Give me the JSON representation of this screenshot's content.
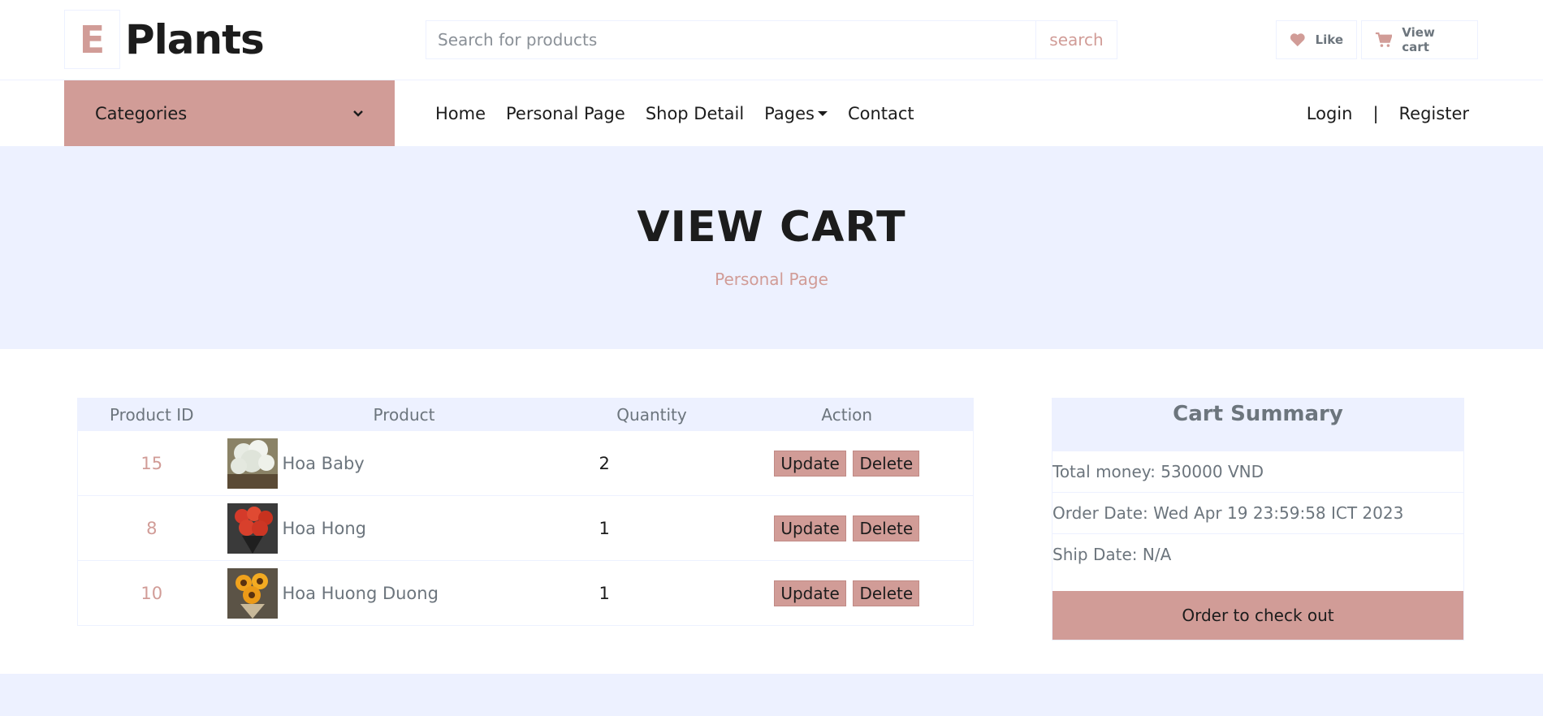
{
  "logo": {
    "letter": "E",
    "name": "Plants"
  },
  "search": {
    "placeholder": "Search for products",
    "button": "search"
  },
  "topbar": {
    "like_label": "Like",
    "cart_label": "View cart"
  },
  "categories": {
    "label": "Categories"
  },
  "nav": {
    "links": [
      "Home",
      "Personal Page",
      "Shop Detail",
      "Pages",
      "Contact"
    ]
  },
  "auth": {
    "login": "Login",
    "separator": "|",
    "register": "Register"
  },
  "hero": {
    "title": "VIEW CART",
    "subtitle": "Personal Page"
  },
  "table": {
    "headers": [
      "Product ID",
      "Product",
      "Quantity",
      "Action"
    ],
    "rows": [
      {
        "id": "15",
        "name": "Hoa Baby",
        "qty": "2",
        "image": "babys-breath-flower-photo"
      },
      {
        "id": "8",
        "name": "Hoa Hong",
        "qty": "1",
        "image": "red-rose-bouquet-photo"
      },
      {
        "id": "10",
        "name": "Hoa Huong Duong",
        "qty": "1",
        "image": "sunflower-bouquet-photo"
      }
    ],
    "update_label": "Update",
    "delete_label": "Delete"
  },
  "summary": {
    "title": "Cart Summary",
    "total": "Total money: 530000 VND",
    "order_date": "Order Date: Wed Apr 19 23:59:58 ICT 2023",
    "ship_date": "Ship Date: N/A",
    "checkout": "Order to check out"
  },
  "colors": {
    "accent": "#d19c97",
    "light_bg": "#edf1ff",
    "text_dark": "#1c1c1c",
    "text_muted": "#6c757d"
  },
  "icons": {
    "like": "heart-icon",
    "cart": "shopping-cart-icon",
    "categories": "chevron-down-icon",
    "pages": "caret-down-icon"
  }
}
